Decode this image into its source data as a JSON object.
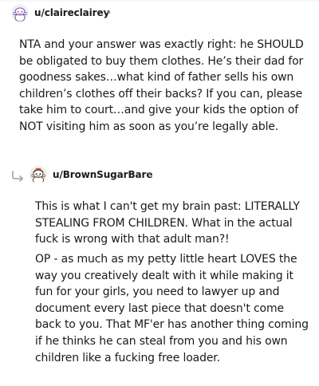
{
  "comment1": {
    "username": "u/claireclairey",
    "separator": "•",
    "avatar_icon": "snoo-avatar-icon",
    "body": "NTA and your answer was exactly right: he SHOULD be obligated to buy them clothes. He’s their dad for goodness sakes…what kind of father sells his own children’s clothes off their backs? If you can, please take him to court…and give your kids the option of NOT visiting him as soon as you’re legally able."
  },
  "comment2": {
    "username": "u/BrownSugarBare",
    "separator": "•",
    "avatar_icon": "snoo-avatar-icon",
    "reply_icon": "reply-arrow-icon",
    "paragraph1": "This is what I can't get my brain past: LITERALLY STEALING FROM CHILDREN. What in the actual fuck is wrong with that adult man?!",
    "paragraph2": "OP - as much as my petty little heart LOVES the way you creatively dealt with it while making it fun for your girls, you need to lawyer up and document every last piece that doesn't come back to you. That MF'er has another thing coming if he thinks he can steal from you and his own children like a fucking free loader."
  },
  "colors": {
    "text": "#1a1a1b",
    "meta": "#878a8c",
    "reply_arrow": "#a0a4a8"
  }
}
